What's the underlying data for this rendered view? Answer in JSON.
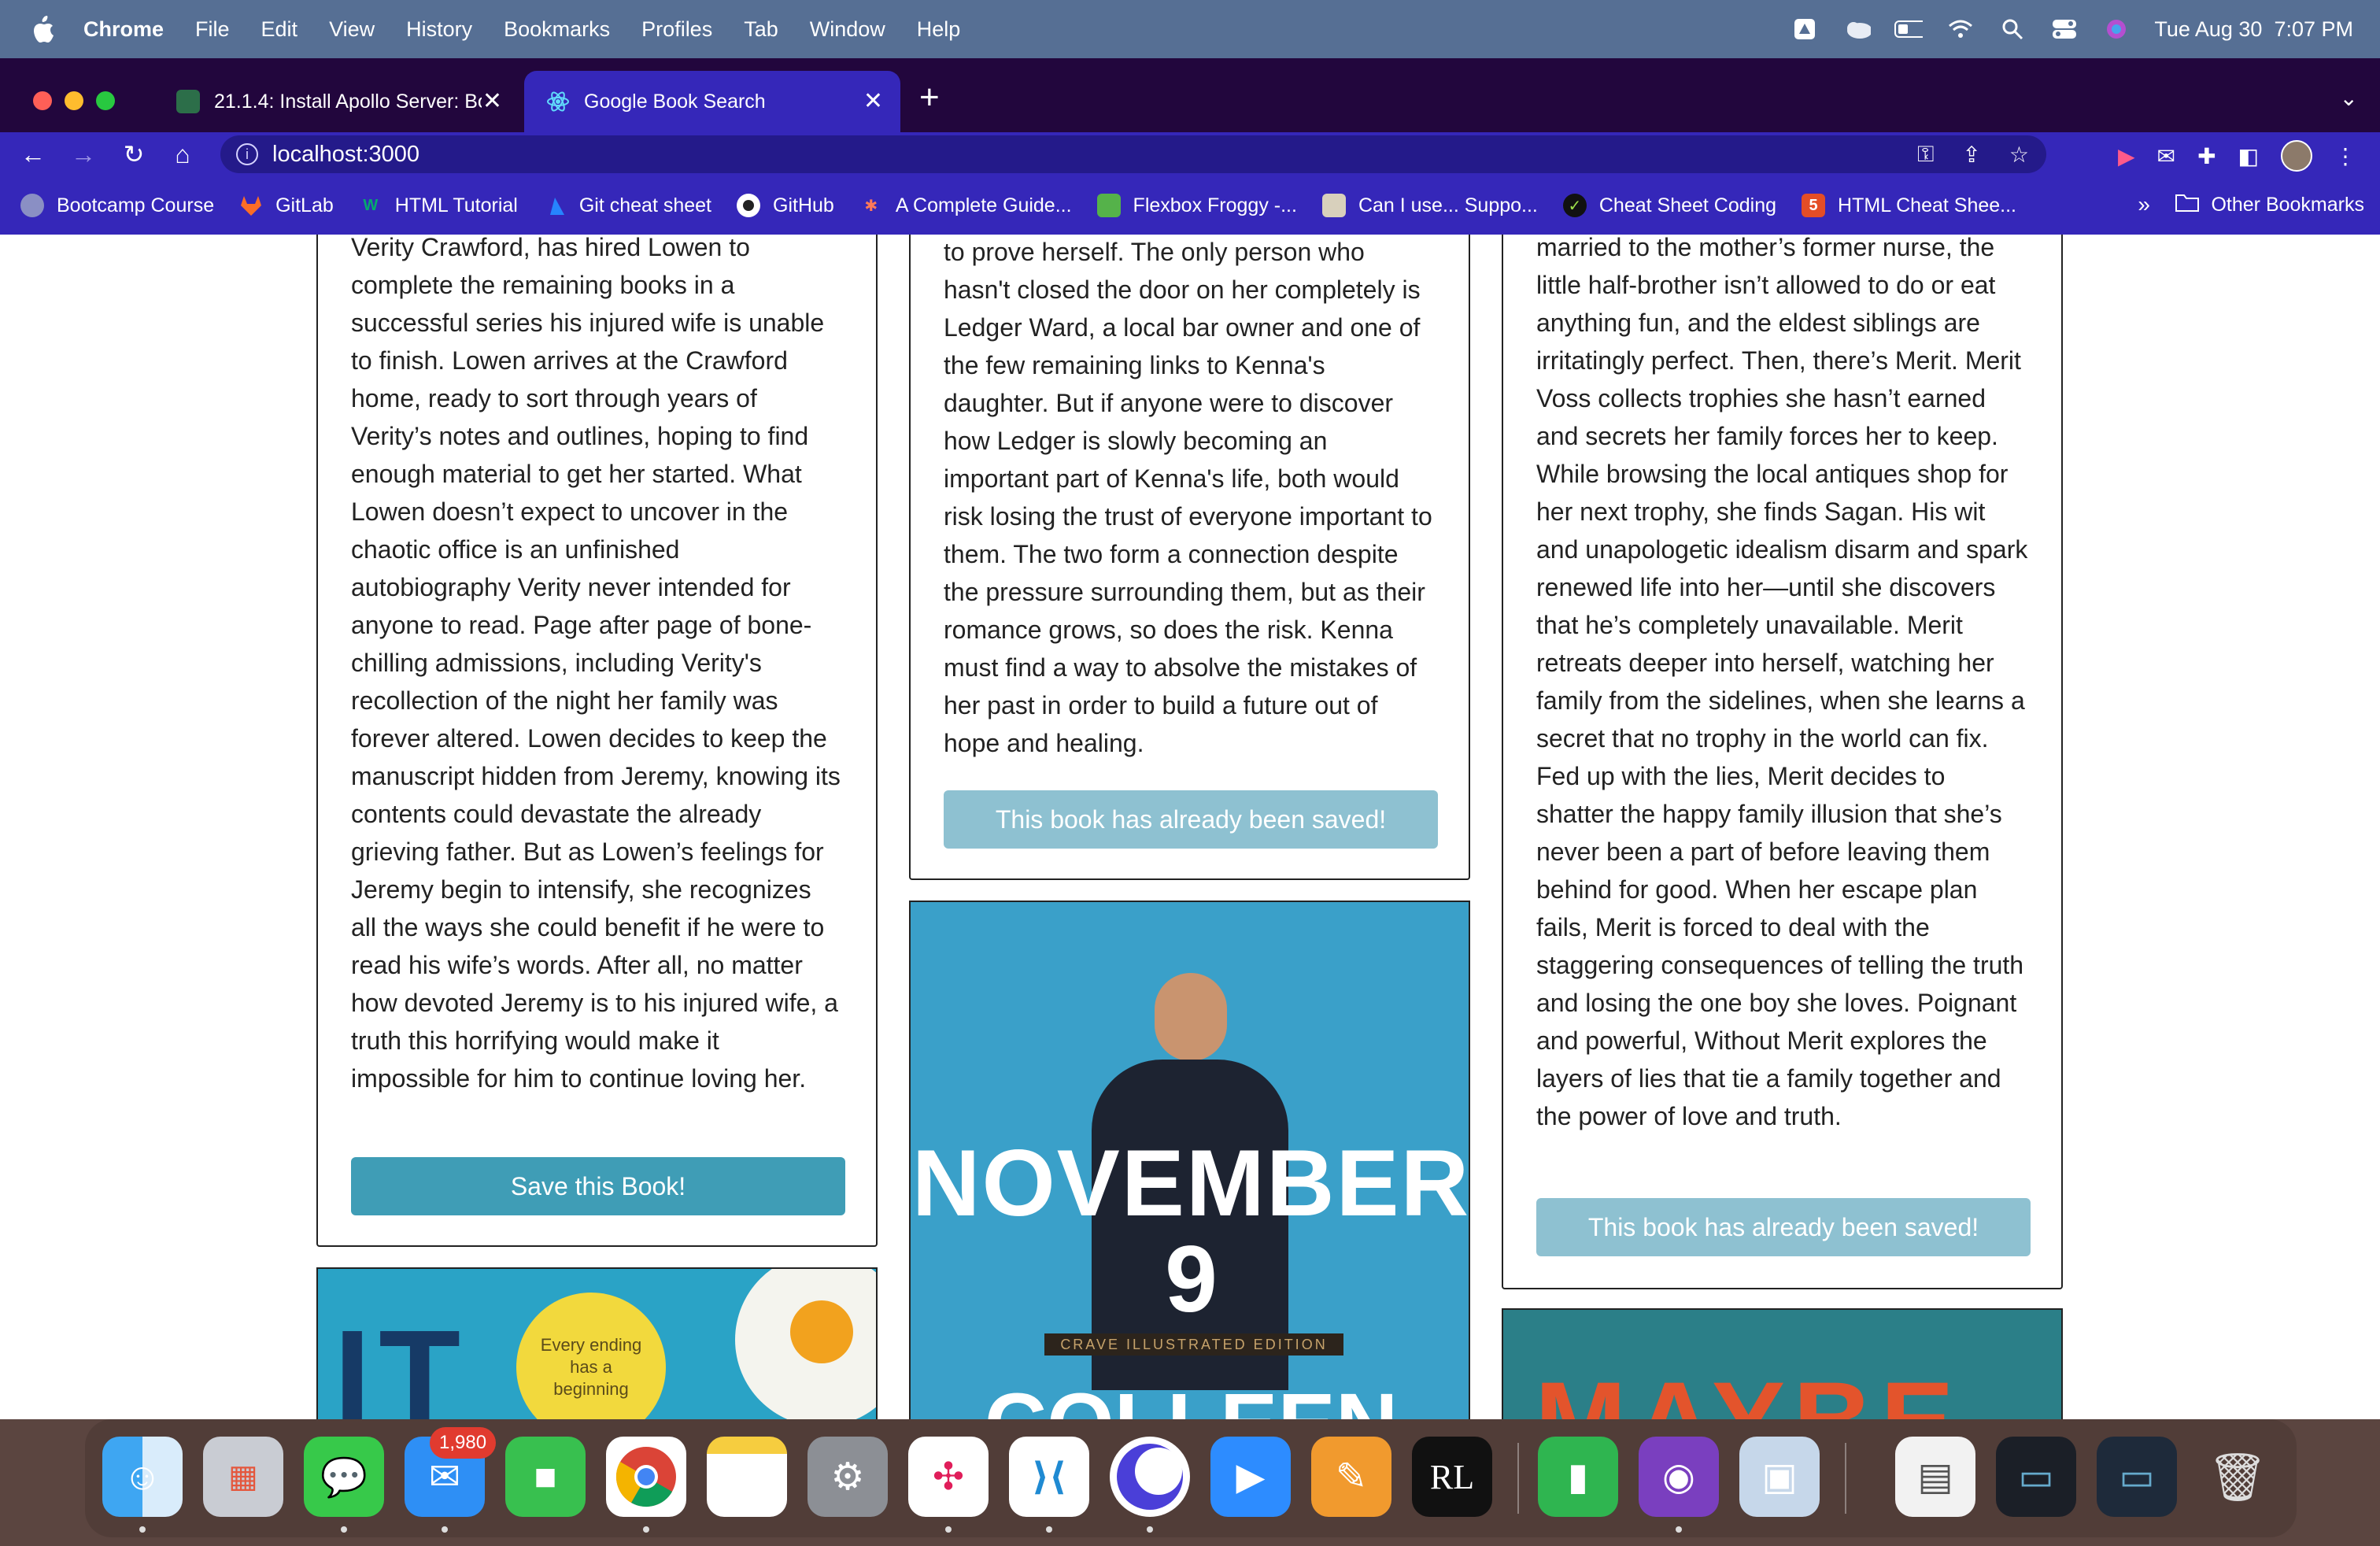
{
  "menubar": {
    "app": "Chrome",
    "items": [
      "File",
      "Edit",
      "View",
      "History",
      "Bookmarks",
      "Profiles",
      "Tab",
      "Window",
      "Help"
    ],
    "datetime": "Tue Aug 30  7:07 PM"
  },
  "tabs": [
    {
      "title": "21.1.4: Install Apollo Server: Bo"
    },
    {
      "title": "Google Book Search"
    }
  ],
  "address": {
    "url": "localhost:3000"
  },
  "bookmarks": [
    {
      "label": "Bootcamp Course"
    },
    {
      "label": "GitLab"
    },
    {
      "label": "HTML Tutorial"
    },
    {
      "label": "Git cheat sheet"
    },
    {
      "label": "GitHub"
    },
    {
      "label": "A Complete Guide..."
    },
    {
      "label": "Flexbox Froggy -..."
    },
    {
      "label": "Can I use... Suppo..."
    },
    {
      "label": "Cheat Sheet Coding"
    },
    {
      "label": "HTML Cheat Shee..."
    }
  ],
  "bookmarks_more": "»",
  "other_bookmarks": "Other Bookmarks",
  "books": [
    {
      "description": "Verity Crawford, has hired Lowen to complete the remaining books in a successful series his injured wife is unable to finish. Lowen arrives at the Crawford home, ready to sort through years of Verity’s notes and outlines, hoping to find enough material to get her started. What Lowen doesn’t expect to uncover in the chaotic office is an unfinished autobiography Verity never intended for anyone to read. Page after page of bone-chilling admissions, including Verity's recollection of the night her family was forever altered. Lowen decides to keep the manuscript hidden from Jeremy, knowing its contents could devastate the already grieving father. But as Lowen’s feelings for Jeremy begin to intensify, she recognizes all the ways she could benefit if he were to read his wife’s words. After all, no matter how devoted Jeremy is to his injured wife, a truth this horrifying would make it impossible for him to continue loving her.",
      "button": "Save this Book!"
    },
    {
      "description": "to prove herself. The only person who hasn't closed the door on her completely is Ledger Ward, a local bar owner and one of the few remaining links to Kenna's daughter. But if anyone were to discover how Ledger is slowly becoming an important part of Kenna's life, both would risk losing the trust of everyone important to them. The two form a connection despite the pressure surrounding them, but as their romance grows, so does the risk. Kenna must find a way to absolve the mistakes of her past in order to build a future out of hope and healing.",
      "button": "This book has already been saved!"
    },
    {
      "description": "married to the mother’s former nurse, the little half-brother isn’t allowed to do or eat anything fun, and the eldest siblings are irritatingly perfect. Then, there’s Merit. Merit Voss collects trophies she hasn’t earned and secrets her family forces her to keep. While browsing the local antiques shop for her next trophy, she finds Sagan. His wit and unapologetic idealism disarm and spark renewed life into her—until she discovers that he’s completely unavailable. Merit retreats deeper into herself, watching her family from the sidelines, when she learns a secret that no trophy in the world can fix. Fed up with the lies, Merit decides to shatter the happy family illusion that she’s never been a part of before leaving them behind for good. When her escape plan fails, Merit is forced to deal with the staggering consequences of telling the truth and losing the one boy she loves. Poignant and powerful, Without Merit explores the layers of lies that tie a family together and the power of love and truth.",
      "button": "This book has already been saved!"
    }
  ],
  "covers": {
    "left": {
      "big_text": "IT",
      "sticker": "Every ending has a beginning"
    },
    "middle": {
      "title": "NOVEMBER",
      "number": "9",
      "edition": "CRAVE ILLUSTRATED EDITION",
      "author": "COLLEEN"
    },
    "right": {
      "text": "MAYBE"
    }
  },
  "dock": {
    "mail_badge": "1,980"
  },
  "colors": {
    "tabstrip": "#22063d",
    "toolbar": "#3527b9",
    "save_button": "#3f9db6",
    "saved_button": "#8ec1d1"
  }
}
